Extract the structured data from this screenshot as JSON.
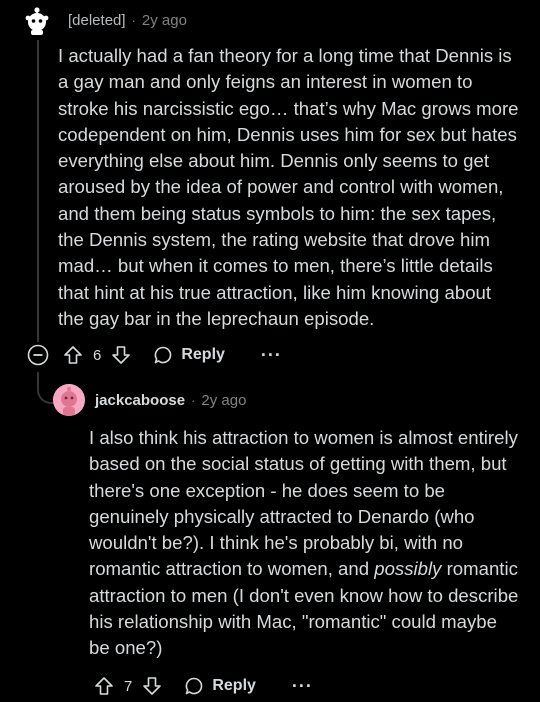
{
  "comments": [
    {
      "author": "[deleted]",
      "separator": "·",
      "age": "2y ago",
      "body": "I actually had a fan theory for a long time that Dennis is a gay man and only feigns an interest in women to stroke his narcissistic ego… that’s why Mac grows more codependent on him, Dennis uses him for sex but hates everything else about him. Dennis only seems to get aroused by the idea of power and control with women, and them being status symbols to him: the sex tapes, the Dennis system, the rating website that drove him mad… but when it comes to men, there’s little details that hint at his true attraction, like him knowing about the gay bar in the leprechaun episode.",
      "votes": "6",
      "reply_label": "Reply",
      "more_label": "···"
    },
    {
      "author": "jackcaboose",
      "separator": "·",
      "age": "2y ago",
      "body_before": "I also think his attraction to women is almost entirely based on the social status of getting with them, but there's one exception - he does seem to be genuinely physically attracted to Denardo (who wouldn't be?). I think he's probably bi, with no romantic attraction to women, and ",
      "body_emphasis": "possibly",
      "body_after": " romantic attraction to men (I don't even know how to describe his relationship with Mac, \"romantic\" could maybe be one?)",
      "votes": "7",
      "reply_label": "Reply",
      "more_label": "···"
    }
  ],
  "colors": {
    "background": "#000000",
    "text": "#d7dadc",
    "muted": "#818384",
    "thread_line": "#343536",
    "user_avatar": "#f6a8c2"
  }
}
